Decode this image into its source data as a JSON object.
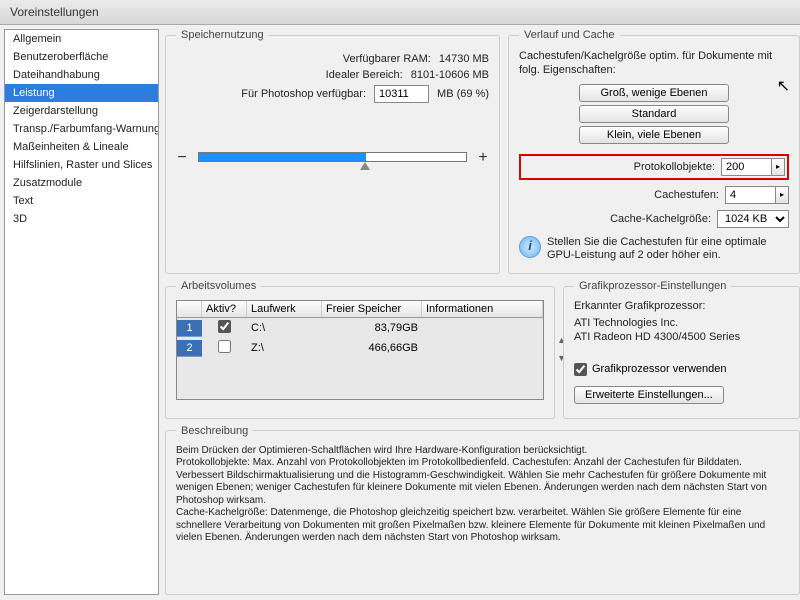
{
  "title": "Voreinstellungen",
  "sidebar": {
    "items": [
      "Allgemein",
      "Benutzeroberfläche",
      "Dateihandhabung",
      "Leistung",
      "Zeigerdarstellung",
      "Transp./Farbumfang-Warnung",
      "Maßeinheiten & Lineale",
      "Hilfslinien, Raster und Slices",
      "Zusatzmodule",
      "Text",
      "3D"
    ],
    "selected": 3
  },
  "memory": {
    "legend": "Speichernutzung",
    "available_label": "Verfügbarer RAM:",
    "available_value": "14730 MB",
    "ideal_label": "Idealer Bereich:",
    "ideal_value": "8101-10606 MB",
    "alloc_label": "Für Photoshop verfügbar:",
    "alloc_value": "10311",
    "alloc_suffix": "MB (69 %)",
    "minus": "−",
    "plus": "+"
  },
  "cache": {
    "legend": "Verlauf und Cache",
    "text": "Cachestufen/Kachelgröße optim. für Dokumente mit folg. Eigenschaften:",
    "btn_large": "Groß, wenige Ebenen",
    "btn_std": "Standard",
    "btn_small": "Klein, viele Ebenen",
    "history_label": "Protokollobjekte:",
    "history_value": "200",
    "levels_label": "Cachestufen:",
    "levels_value": "4",
    "tile_label": "Cache-Kachelgröße:",
    "tile_value": "1024 KB",
    "info": "Stellen Sie die Cachestufen für eine optimale GPU-Leistung auf 2 oder höher ein."
  },
  "volumes": {
    "legend": "Arbeitsvolumes",
    "headers": [
      "",
      "Aktiv?",
      "Laufwerk",
      "Freier Speicher",
      "Informationen"
    ],
    "rows": [
      {
        "idx": "1",
        "active": true,
        "drive": "C:\\",
        "free": "83,79GB"
      },
      {
        "idx": "2",
        "active": false,
        "drive": "Z:\\",
        "free": "466,66GB"
      }
    ],
    "up": "▲",
    "down": "▼"
  },
  "gpu": {
    "legend": "Grafikprozessor-Einstellungen",
    "detected_label": "Erkannter Grafikprozessor:",
    "vendor": "ATI Technologies Inc.",
    "model": "ATI Radeon HD 4300/4500 Series",
    "use_label": "Grafikprozessor verwenden",
    "advanced": "Erweiterte Einstellungen..."
  },
  "description": {
    "legend": "Beschreibung",
    "text": "Beim Drücken der Optimieren-Schaltflächen wird Ihre Hardware-Konfiguration berücksichtigt.\nProtokollobjekte: Max. Anzahl von Protokollobjekten im Protokollbedienfeld. Cachestufen: Anzahl der Cachestufen für Bilddaten. Verbessert Bildschirmaktualisierung und die Histogramm-Geschwindigkeit. Wählen Sie mehr Cachestufen für größere Dokumente mit wenigen Ebenen; weniger Cachestufen für kleinere Dokumente mit vielen Ebenen. Änderungen werden nach dem nächsten Start von Photoshop wirksam.\nCache-Kachelgröße: Datenmenge, die Photoshop gleichzeitig speichert bzw. verarbeitet. Wählen Sie größere Elemente für eine schnellere Verarbeitung von Dokumenten mit großen Pixelmaßen bzw. kleinere Elemente für Dokumente mit kleinen Pixelmaßen und vielen Ebenen. Änderungen werden nach dem nächsten Start von Photoshop wirksam."
  }
}
